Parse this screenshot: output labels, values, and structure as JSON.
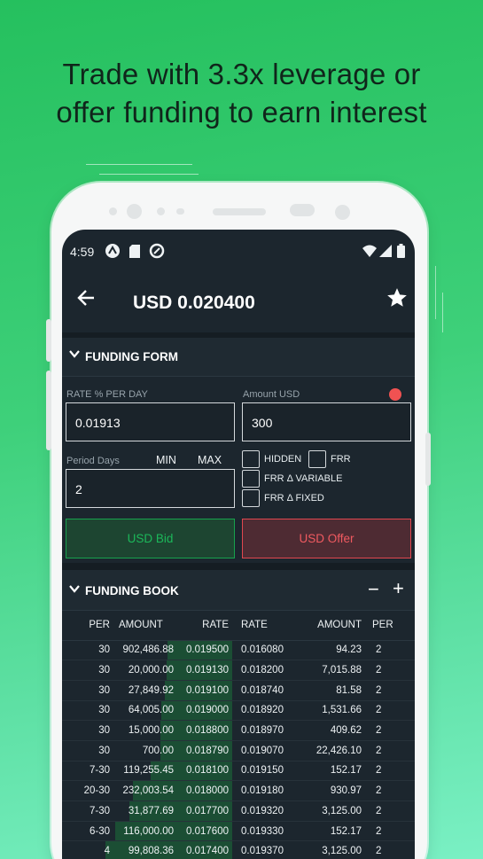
{
  "promo": {
    "line1": "Trade with 3.3x leverage or",
    "line2": "offer funding to earn interest"
  },
  "status_bar": {
    "time": "4:59"
  },
  "app_bar": {
    "title": "USD 0.020400"
  },
  "funding_form": {
    "header": "FUNDING FORM",
    "rate_label": "RATE % PER DAY",
    "rate_value": "0.01913",
    "amount_label": "Amount USD",
    "amount_value": "300",
    "period_label": "Period Days",
    "min_label": "MIN",
    "max_label": "MAX",
    "period_value": "2",
    "checkboxes": {
      "hidden": "HIDDEN",
      "frr": "FRR",
      "frr_variable": "FRR Δ VARIABLE",
      "frr_fixed": "FRR Δ FIXED"
    },
    "bid_label": "USD Bid",
    "offer_label": "USD Offer"
  },
  "funding_book": {
    "header": "FUNDING BOOK",
    "columns": [
      "PER",
      "AMOUNT",
      "RATE",
      "RATE",
      "AMOUNT",
      "PER"
    ],
    "rows": [
      [
        "30",
        "902,486.88",
        "0.019500",
        "0.016080",
        "94.23",
        "2"
      ],
      [
        "30",
        "20,000.00",
        "0.019130",
        "0.018200",
        "7,015.88",
        "2"
      ],
      [
        "30",
        "27,849.92",
        "0.019100",
        "0.018740",
        "81.58",
        "2"
      ],
      [
        "30",
        "64,005.00",
        "0.019000",
        "0.018920",
        "1,531.66",
        "2"
      ],
      [
        "30",
        "15,000.00",
        "0.018800",
        "0.018970",
        "409.62",
        "2"
      ],
      [
        "30",
        "700.00",
        "0.018790",
        "0.019070",
        "22,426.10",
        "2"
      ],
      [
        "7-30",
        "119,255.45",
        "0.018100",
        "0.019150",
        "152.17",
        "2"
      ],
      [
        "20-30",
        "232,003.54",
        "0.018000",
        "0.019180",
        "930.97",
        "2"
      ],
      [
        "7-30",
        "31,877.69",
        "0.017700",
        "0.019320",
        "3,125.00",
        "2"
      ],
      [
        "6-30",
        "116,000.00",
        "0.017600",
        "0.019330",
        "152.17",
        "2"
      ],
      [
        "4",
        "99,808.36",
        "0.017400",
        "0.019370",
        "3,125.00",
        "2"
      ]
    ],
    "bid_depth_fraction": [
      0.45,
      0.46,
      0.47,
      0.5,
      0.51,
      0.51,
      0.58,
      0.72,
      0.75,
      0.86,
      0.94
    ]
  },
  "colors": {
    "background_gradient_start": "#25c05e",
    "screen_bg": "#1c262e",
    "bid_green": "#1cb85a",
    "offer_red": "#f05a60",
    "bid_depth": "#1b4e34"
  }
}
